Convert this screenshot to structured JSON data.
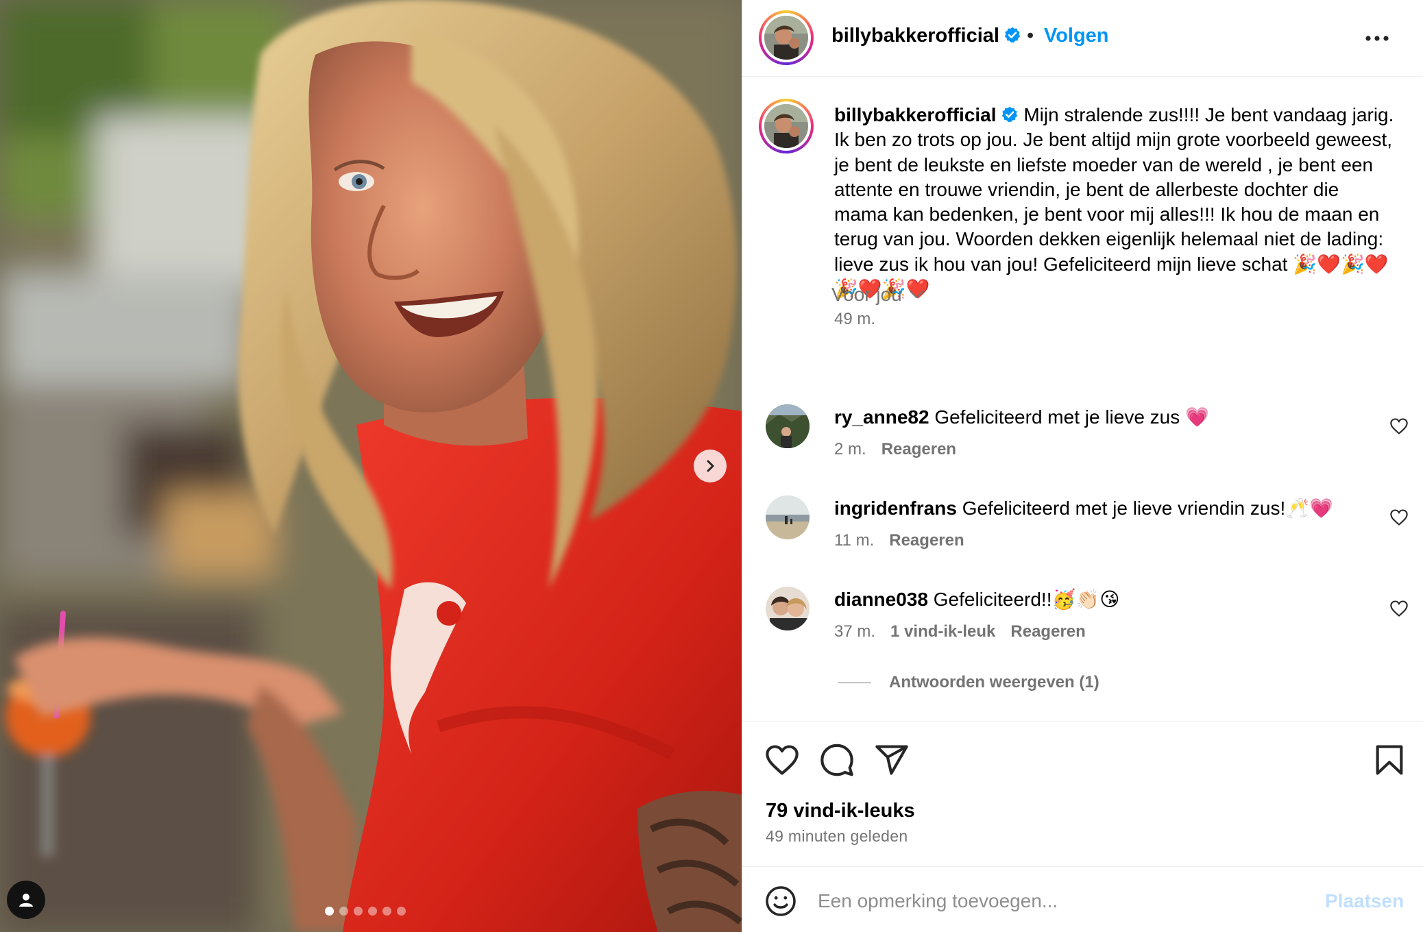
{
  "post": {
    "username": "billybakkerofficial",
    "separator": "•",
    "follow_label": "Volgen",
    "more_icon": "more-horizontal-icon",
    "verified_icon": "verified-badge-icon",
    "image_count": 6,
    "active_image": 1
  },
  "caption": {
    "username": "billybakkerofficial",
    "text": "Mijn stralende zus!!!! Je bent vandaag jarig. Ik ben zo trots op jou. Je bent altijd mijn grote voorbeeld geweest, je bent de leukste en liefste moeder van de wereld , je bent een attente en trouwe vriendin, je bent de allerbeste dochter die mama kan bedenken, je bent voor mij alles!!! Ik hou de maan en terug van jou. Woorden dekken eigenlijk helemaal niet de lading: lieve zus ik hou van jou! Gefeliciteerd mijn lieve schat 🎉❤️🎉❤️🎉❤️🎉❤️",
    "time": "49 m."
  },
  "filter": {
    "label": "Voor jou"
  },
  "comments": [
    {
      "username": "ry_anne82",
      "text": "Gefeliciteerd met je lieve zus 💗",
      "time": "2 m.",
      "likes": "",
      "reply": "Reageren"
    },
    {
      "username": "ingridenfrans",
      "text": "Gefeliciteerd met je lieve vriendin zus!🥂💗",
      "time": "11 m.",
      "likes": "",
      "reply": "Reageren"
    },
    {
      "username": "dianne038",
      "text": "Gefeliciteerd!!🥳👏🏻😘",
      "time": "37 m.",
      "likes": "1 vind-ik-leuk",
      "reply": "Reageren"
    }
  ],
  "replies_label": "Antwoorden weergeven (1)",
  "actions": {
    "like_icon": "heart-icon",
    "comment_icon": "comment-bubble-icon",
    "share_icon": "send-icon",
    "save_icon": "bookmark-icon"
  },
  "likes_text": "79 vind-ik-leuks",
  "posted_text": "49 minuten geleden",
  "add_comment": {
    "placeholder": "Een opmerking toevoegen...",
    "post_label": "Plaatsen"
  },
  "colors": {
    "accent": "#0095f6",
    "muted": "#737373",
    "post_disabled": "#c0dffd",
    "divider": "#efefef"
  }
}
